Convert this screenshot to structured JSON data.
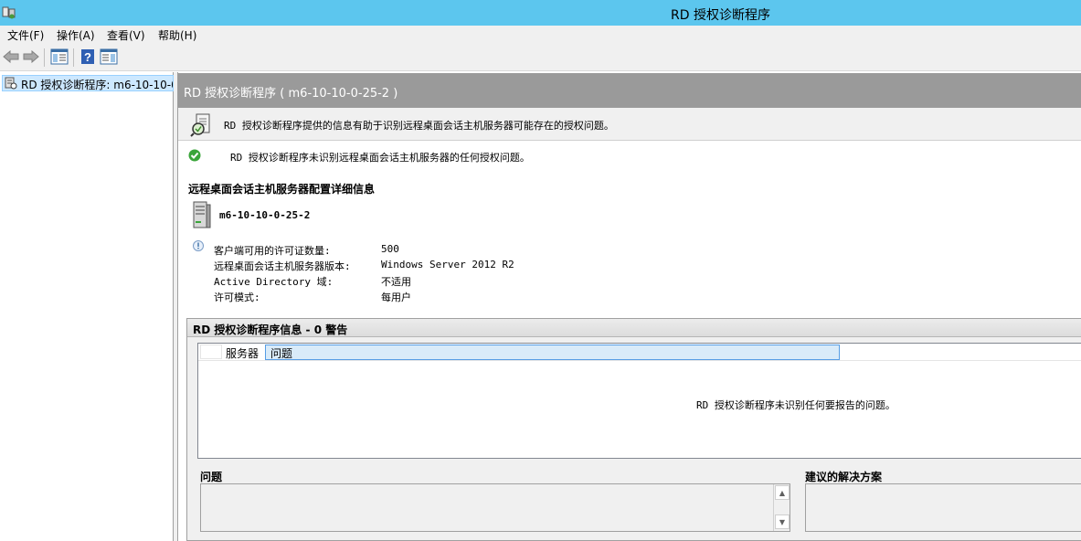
{
  "window": {
    "title": "RD 授权诊断程序",
    "titlebar_color": "#5cc6ee",
    "app_icon": "rd-licensing-app-icon"
  },
  "menu": {
    "items": [
      {
        "label": "文件(F)"
      },
      {
        "label": "操作(A)"
      },
      {
        "label": "查看(V)"
      },
      {
        "label": "帮助(H)"
      }
    ]
  },
  "toolbar": {
    "buttons": [
      "back-arrow-icon",
      "forward-arrow-icon",
      "show-hide-console-tree-icon",
      "help-icon",
      "show-hide-action-pane-icon"
    ]
  },
  "tree": {
    "selected_item": "RD 授权诊断程序: m6-10-10-0"
  },
  "content": {
    "header": "RD 授权诊断程序 ( m6-10-10-0-25-2 )",
    "info_strip": "RD 授权诊断程序提供的信息有助于识别远程桌面会话主机服务器可能存在的授权问题。",
    "ok_message": "RD 授权诊断程序未识别远程桌面会话主机服务器的任何授权问题。",
    "config_heading": "远程桌面会话主机服务器配置详细信息",
    "server_name": "m6-10-10-0-25-2",
    "details": [
      {
        "label": "客户端可用的许可证数量:",
        "value": "500"
      },
      {
        "label": "远程桌面会话主机服务器版本:",
        "value": "Windows Server 2012 R2"
      },
      {
        "label": "Active Directory 域:",
        "value": "不适用"
      },
      {
        "label": "许可模式:",
        "value": "每用户"
      }
    ]
  },
  "warnings_section": {
    "title": "RD 授权诊断程序信息 - 0 警告",
    "columns": {
      "server": "服务器",
      "issue": "问题"
    },
    "empty_message": "RD 授权诊断程序未识别任何要报告的问题。",
    "issue_label": "问题",
    "solution_label": "建议的解决方案"
  },
  "colors": {
    "header_bg": "#9a9a9a",
    "selection_bg": "#cde8ff",
    "ok_green": "#3aa53a"
  }
}
